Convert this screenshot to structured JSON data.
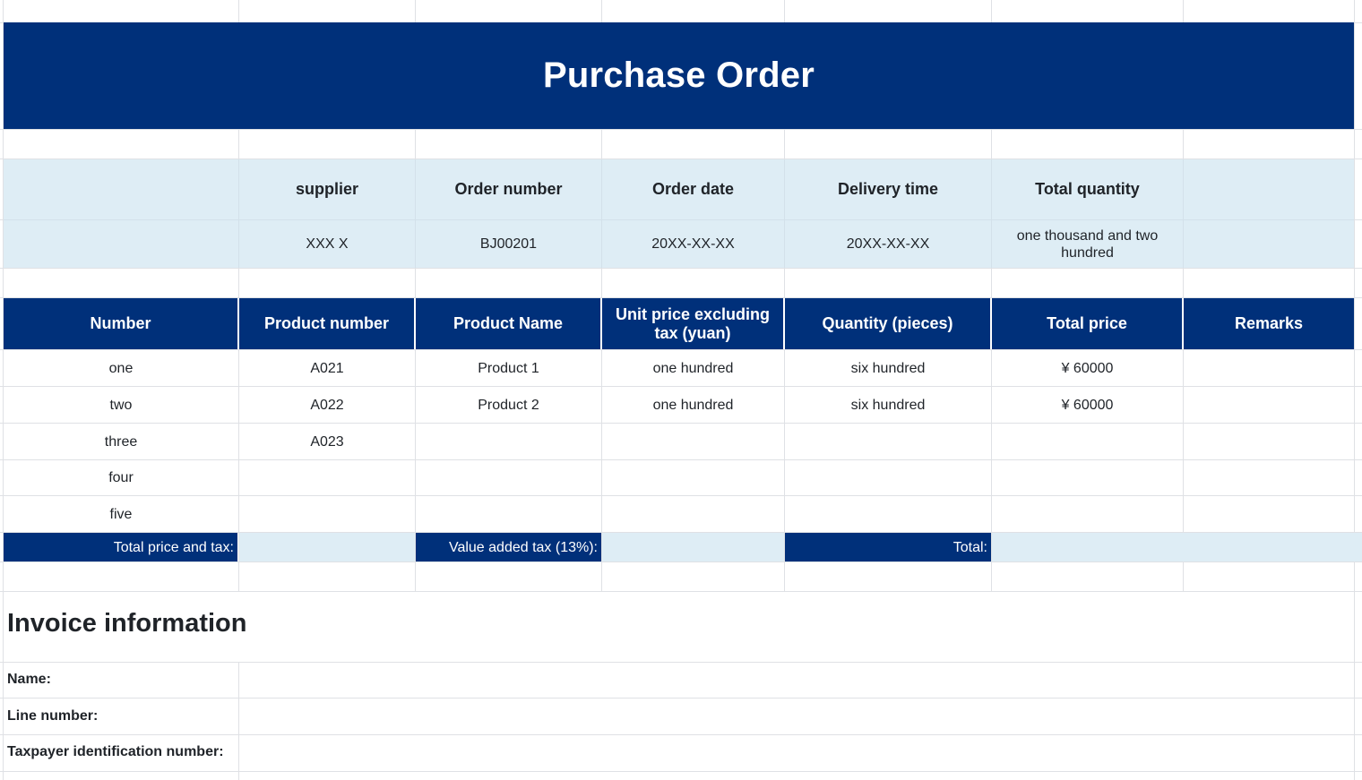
{
  "title": "Purchase Order",
  "summary": {
    "headers": [
      "supplier",
      "Order number",
      "Order date",
      "Delivery time",
      "Total quantity"
    ],
    "values": [
      "XXX X",
      "BJ00201",
      "20XX-XX-XX",
      "20XX-XX-XX",
      "one thousand and two hundred"
    ]
  },
  "table": {
    "columns": [
      "Number",
      "Product number",
      "Product Name",
      "Unit price excluding tax (yuan)",
      "Quantity (pieces)",
      "Total price",
      "Remarks"
    ],
    "rows": [
      [
        "one",
        "A021",
        "Product 1",
        "one hundred",
        "six hundred",
        "¥ 60000",
        ""
      ],
      [
        "two",
        "A022",
        "Product 2",
        "one hundred",
        "six hundred",
        "¥ 60000",
        ""
      ],
      [
        "three",
        "A023",
        "",
        "",
        "",
        "",
        ""
      ],
      [
        "four",
        "",
        "",
        "",
        "",
        "",
        ""
      ],
      [
        "five",
        "",
        "",
        "",
        "",
        "",
        ""
      ]
    ]
  },
  "totals": {
    "total_price_tax_label": "Total price and tax:",
    "vat_label": "Value added tax (13%):",
    "total_label": "Total:"
  },
  "invoice": {
    "title": "Invoice information",
    "name_label": "Name:",
    "line_number_label": "Line number:",
    "taxpayer_label": "Taxpayer identification number:"
  },
  "colors": {
    "navy": "#00307a",
    "light_blue": "#deedf5",
    "grid": "#dfe1e5"
  }
}
